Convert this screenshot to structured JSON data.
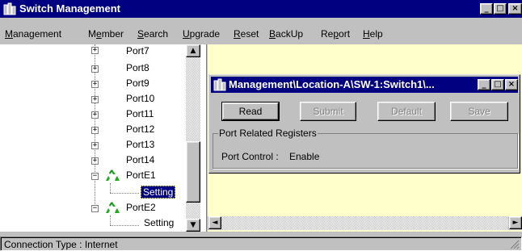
{
  "window": {
    "title": "Switch Management",
    "min": "_",
    "max": "□",
    "close": "×"
  },
  "menu": [
    {
      "label": "Management",
      "ul": "M",
      "rest": "anagement"
    },
    {
      "label": "Member",
      "pre": "M",
      "ul": "e",
      "rest": "mber"
    },
    {
      "label": "Search",
      "ul": "S",
      "rest": "earch"
    },
    {
      "label": "Upgrade",
      "ul": "U",
      "rest": "pgrade"
    },
    {
      "label": "Reset",
      "ul": "R",
      "rest": "eset"
    },
    {
      "label": "BackUp",
      "ul": "B",
      "rest": "ackUp"
    },
    {
      "label": "Report",
      "pre": "Re",
      "ul": "p",
      "rest": "ort"
    },
    {
      "label": "Help",
      "ul": "H",
      "rest": "elp"
    }
  ],
  "tree": {
    "ports": [
      "Port7",
      "Port8",
      "Port9",
      "Port10",
      "Port11",
      "Port12",
      "Port13",
      "Port14"
    ],
    "porte1": {
      "label": "PortE1",
      "child": "Setting"
    },
    "porte2": {
      "label": "PortE2",
      "child": "Setting"
    },
    "expander_collapsed": "+",
    "expander_expanded": "−"
  },
  "child_window": {
    "title": "Management\\Location-A\\SW-1:Switch1\\...",
    "buttons": {
      "read": "Read",
      "submit": "Submit",
      "default": "Default",
      "save": "Save"
    },
    "group_label": "Port Related Registers",
    "port_control_label": "Port Control :",
    "port_control_value": "Enable"
  },
  "scroll_arrows": {
    "up": "▲",
    "down": "▼",
    "left": "◄",
    "right": "►"
  },
  "status": {
    "connection": "Connection Type : Internet"
  },
  "colors": {
    "titlebar": "#000080",
    "workspace": "#ffffcc",
    "selected": "#000080"
  }
}
